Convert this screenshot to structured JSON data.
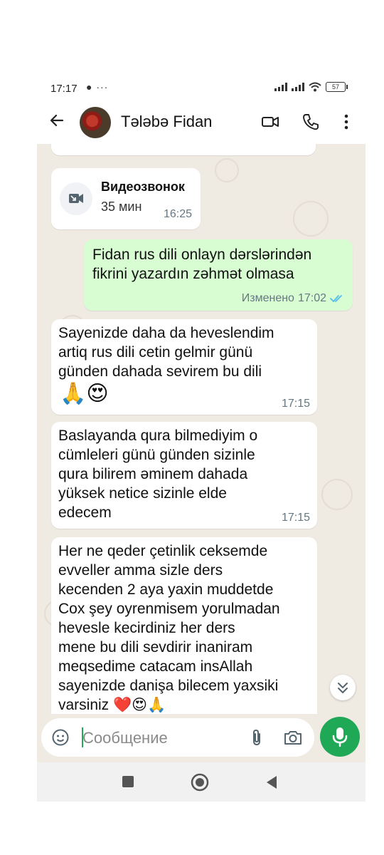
{
  "status_bar": {
    "time": "17:17",
    "extra": "●  ···",
    "battery": "57"
  },
  "header": {
    "contact_name": "Tələbə Fidan"
  },
  "messages": [
    {
      "type": "call",
      "title": "Видеозвонок",
      "duration": "35 мин",
      "time": "16:25"
    },
    {
      "type": "outgoing",
      "text": "Fidan rus dili onlayn dərslərindən fikrini yazardın zəhmət olmasa",
      "edited": "Изменено",
      "time": "17:02"
    },
    {
      "type": "incoming",
      "text": "Sayenizde daha da heveslendim\nartiq rus dili cetin gelmir günü\ngünden dahada sevirem bu dili",
      "emoji": "🙏😍",
      "time": "17:15"
    },
    {
      "type": "incoming",
      "text": "Baslayanda qura bilmediyim o\ncümleleri günü günden sizinle\nqura bilirem əminem dahada\nyüksek netice sizinle elde\nedecem",
      "time": "17:15"
    },
    {
      "type": "incoming",
      "text": "Her ne qeder çetinlik ceksemde\nevveller amma sizle ders\nkecenden 2 aya yaxin muddetde\nCox şey oyrenmisem yorulmadan\nhevesle kecirdiniz her ders\nmene bu dili sevdirir inaniram\nmeqsedime catacam insAllah\nsayenizde danişa bilecem yaxsiki\nvarsiniz ❤️😍🙏"
    }
  ],
  "input": {
    "placeholder": "Сообщение"
  },
  "colors": {
    "outgoing": "#d9fdd3",
    "incoming": "#ffffff",
    "accent": "#1fa855",
    "chat_bg": "#efeae2"
  }
}
